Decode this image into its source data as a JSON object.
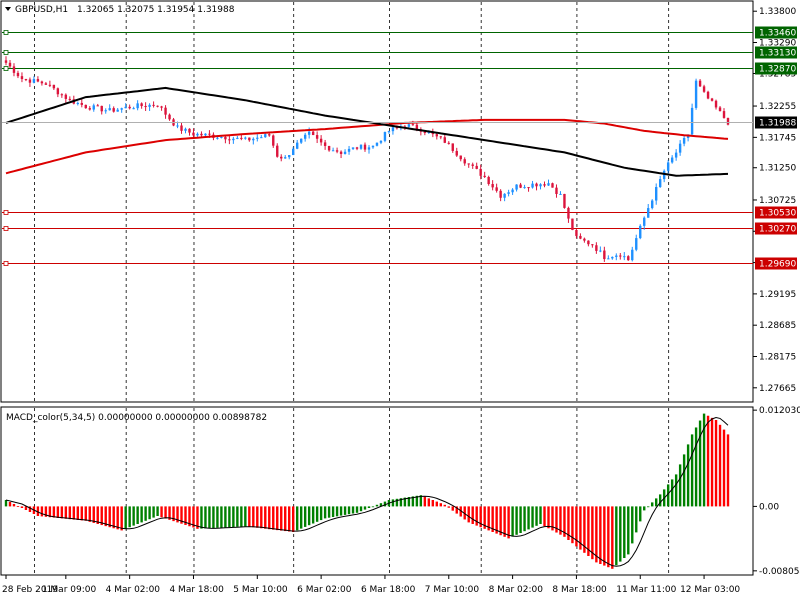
{
  "header": {
    "symbol": "GBPUSD,H1",
    "ohlc": "1.32065 1.32075 1.31954 1.31988"
  },
  "macd_header": "MACD_color(5,34,5) 0.00000000 0.00000000 0.00898782",
  "price_axis": {
    "ticks": [
      {
        "label": "1.33800",
        "value": 1.338
      },
      {
        "label": "1.33290",
        "value": 1.3329
      },
      {
        "label": "1.32785",
        "value": 1.32785
      },
      {
        "label": "1.32255",
        "value": 1.32255
      },
      {
        "label": "1.31745",
        "value": 1.31745
      },
      {
        "label": "1.31250",
        "value": 1.3125
      },
      {
        "label": "1.30725",
        "value": 1.30725
      },
      {
        "label": "1.30215",
        "value": 1.30215
      },
      {
        "label": "1.29705",
        "value": 1.29705
      },
      {
        "label": "1.29195",
        "value": 1.29195
      },
      {
        "label": "1.28685",
        "value": 1.28685
      },
      {
        "label": "1.28175",
        "value": 1.28175
      },
      {
        "label": "1.27665",
        "value": 1.27665
      }
    ]
  },
  "current_price": {
    "label": "1.31988",
    "value": 1.31988,
    "color": "#000000"
  },
  "levels": [
    {
      "label": "1.33460",
      "value": 1.3346,
      "color": "#006400"
    },
    {
      "label": "1.33130",
      "value": 1.3313,
      "color": "#006400"
    },
    {
      "label": "1.32870",
      "value": 1.3287,
      "color": "#006400"
    },
    {
      "label": "1.30530",
      "value": 1.3053,
      "color": "#cc0000"
    },
    {
      "label": "1.30270",
      "value": 1.3027,
      "color": "#cc0000"
    },
    {
      "label": "1.29690",
      "value": 1.2969,
      "color": "#cc0000"
    }
  ],
  "macd_axis": {
    "ticks": [
      {
        "label": "0.0120303",
        "value": 0.0120303
      },
      {
        "label": "0.00",
        "value": 0
      },
      {
        "label": "-0.008054",
        "value": -0.008054
      }
    ]
  },
  "time_axis": {
    "labels": [
      {
        "label": "28 Feb 2019",
        "index": 0
      },
      {
        "label": "1 Mar 09:00",
        "index": 15
      },
      {
        "label": "4 Mar 02:00",
        "index": 31
      },
      {
        "label": "4 Mar 18:00",
        "index": 47
      },
      {
        "label": "5 Mar 10:00",
        "index": 63
      },
      {
        "label": "6 Mar 02:00",
        "index": 79
      },
      {
        "label": "6 Mar 18:00",
        "index": 95
      },
      {
        "label": "7 Mar 10:00",
        "index": 111
      },
      {
        "label": "8 Mar 02:00",
        "index": 127
      },
      {
        "label": "8 Mar 18:00",
        "index": 143
      },
      {
        "label": "11 Mar 11:00",
        "index": 159
      },
      {
        "label": "12 Mar 03:00",
        "index": 175
      }
    ],
    "separators": [
      7,
      30,
      47,
      72,
      96,
      119,
      143,
      166
    ]
  },
  "colors": {
    "bull": "#1e90ff",
    "bear": "#dc143c",
    "ma_black": "#000000",
    "ma_red": "#dc0000",
    "macd_up": "#008000",
    "macd_down": "#ff0000",
    "signal": "#000000",
    "level_green": "#006400",
    "level_red": "#cc0000"
  },
  "chart_data": {
    "type": "line",
    "title": "",
    "symbol": "GBPUSD",
    "timeframe": "H1",
    "price_range": [
      1.2745,
      1.3395
    ],
    "close_anchors": [
      [
        0,
        1.3296
      ],
      [
        4,
        1.327
      ],
      [
        10,
        1.3262
      ],
      [
        16,
        1.3235
      ],
      [
        20,
        1.3225
      ],
      [
        26,
        1.3218
      ],
      [
        32,
        1.3225
      ],
      [
        38,
        1.3228
      ],
      [
        43,
        1.319
      ],
      [
        47,
        1.318
      ],
      [
        55,
        1.3175
      ],
      [
        60,
        1.317
      ],
      [
        66,
        1.3178
      ],
      [
        68,
        1.3145
      ],
      [
        70,
        1.314
      ],
      [
        72,
        1.3158
      ],
      [
        76,
        1.318
      ],
      [
        80,
        1.316
      ],
      [
        84,
        1.315
      ],
      [
        88,
        1.3158
      ],
      [
        92,
        1.316
      ],
      [
        96,
        1.3185
      ],
      [
        100,
        1.3195
      ],
      [
        104,
        1.3188
      ],
      [
        110,
        1.3168
      ],
      [
        116,
        1.313
      ],
      [
        120,
        1.311
      ],
      [
        124,
        1.308
      ],
      [
        128,
        1.3095
      ],
      [
        132,
        1.3098
      ],
      [
        136,
        1.31
      ],
      [
        139,
        1.308
      ],
      [
        141,
        1.304
      ],
      [
        143,
        1.301
      ],
      [
        147,
        1.3
      ],
      [
        150,
        1.298
      ],
      [
        154,
        1.2985
      ],
      [
        156,
        1.2975
      ],
      [
        158,
        1.301
      ],
      [
        161,
        1.306
      ],
      [
        165,
        1.312
      ],
      [
        168,
        1.315
      ],
      [
        171,
        1.318
      ],
      [
        173,
        1.3265
      ],
      [
        175,
        1.3245
      ],
      [
        178,
        1.3222
      ],
      [
        181,
        1.3199
      ]
    ],
    "ma_black_anchors": [
      [
        0,
        1.3198
      ],
      [
        20,
        1.324
      ],
      [
        40,
        1.3255
      ],
      [
        60,
        1.3235
      ],
      [
        80,
        1.321
      ],
      [
        100,
        1.319
      ],
      [
        120,
        1.317
      ],
      [
        140,
        1.315
      ],
      [
        155,
        1.3125
      ],
      [
        168,
        1.3112
      ],
      [
        181,
        1.3115
      ]
    ],
    "ma_red_anchors": [
      [
        0,
        1.3116
      ],
      [
        20,
        1.315
      ],
      [
        40,
        1.317
      ],
      [
        60,
        1.318
      ],
      [
        80,
        1.3188
      ],
      [
        100,
        1.3198
      ],
      [
        120,
        1.3203
      ],
      [
        140,
        1.3203
      ],
      [
        150,
        1.3197
      ],
      [
        160,
        1.3185
      ],
      [
        170,
        1.3178
      ],
      [
        181,
        1.3172
      ]
    ],
    "macd_anchors": [
      [
        0,
        0.0008
      ],
      [
        8,
        -0.0012
      ],
      [
        20,
        -0.0018
      ],
      [
        29,
        -0.003
      ],
      [
        38,
        -0.0012
      ],
      [
        48,
        -0.0028
      ],
      [
        60,
        -0.0025
      ],
      [
        72,
        -0.0032
      ],
      [
        80,
        -0.0015
      ],
      [
        88,
        -0.0008
      ],
      [
        96,
        0.0008
      ],
      [
        104,
        0.0014
      ],
      [
        110,
        0.0002
      ],
      [
        116,
        -0.002
      ],
      [
        126,
        -0.004
      ],
      [
        134,
        -0.0022
      ],
      [
        140,
        -0.0038
      ],
      [
        148,
        -0.007
      ],
      [
        152,
        -0.0078
      ],
      [
        156,
        -0.006
      ],
      [
        160,
        -0.0005
      ],
      [
        164,
        0.0015
      ],
      [
        168,
        0.004
      ],
      [
        172,
        0.009
      ],
      [
        175,
        0.0116
      ],
      [
        178,
        0.0108
      ],
      [
        181,
        0.009
      ]
    ],
    "macd_range": [
      -0.00845,
      0.0123
    ],
    "grid": false,
    "legend": "none"
  }
}
